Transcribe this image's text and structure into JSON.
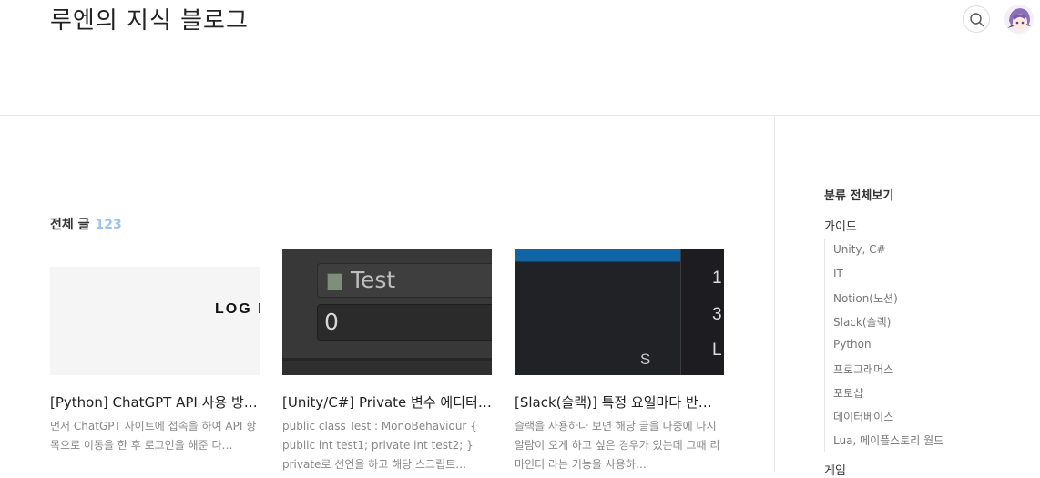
{
  "header": {
    "blog_title": "루엔의 지식 블로그"
  },
  "section": {
    "title": "전체 글",
    "count": "123"
  },
  "posts": [
    {
      "title": "[Python] ChatGPT API 사용 방법 (API 키 발급)",
      "summary": "먼저 ChatGPT 사이트에 접속을 하여 API 항목으로 이동을 한 후 로그인을 해준 다…",
      "thumb_text": "LOG I"
    },
    {
      "title": "[Unity/C#] Private 변수 에디터에 표시하기",
      "summary": "public class Test : MonoBehaviour { public int test1; private int test2; } private로 선언을 하고 해당 스크립트…",
      "thumb_label": "Test",
      "thumb_value": "0"
    },
    {
      "title": "[Slack(슬랙)] 특정 요일마다 반복 알림 설정",
      "summary": "슬랙을 사용하다 보면 해당 글을 나중에 다시 알람이 오게 하고 싶은 경우가 있는데 그때 리마인더 라는 기능을 사용하…",
      "thumb_chars": [
        "S",
        "1",
        "3",
        "L"
      ]
    }
  ],
  "sidebar": {
    "all_label": "분류 전체보기",
    "groups": [
      {
        "label": "가이드",
        "items": [
          "Unity, C#",
          "IT",
          "Notion(노션)",
          "Slack(슬랙)",
          "Python",
          "프로그래머스",
          "포토샵",
          "데이터베이스",
          "Lua, 메이플스토리 월드"
        ]
      },
      {
        "label": "게임"
      }
    ]
  },
  "colors": {
    "accent_count": "#9cc3ec",
    "slack_blue": "#1264a3"
  }
}
